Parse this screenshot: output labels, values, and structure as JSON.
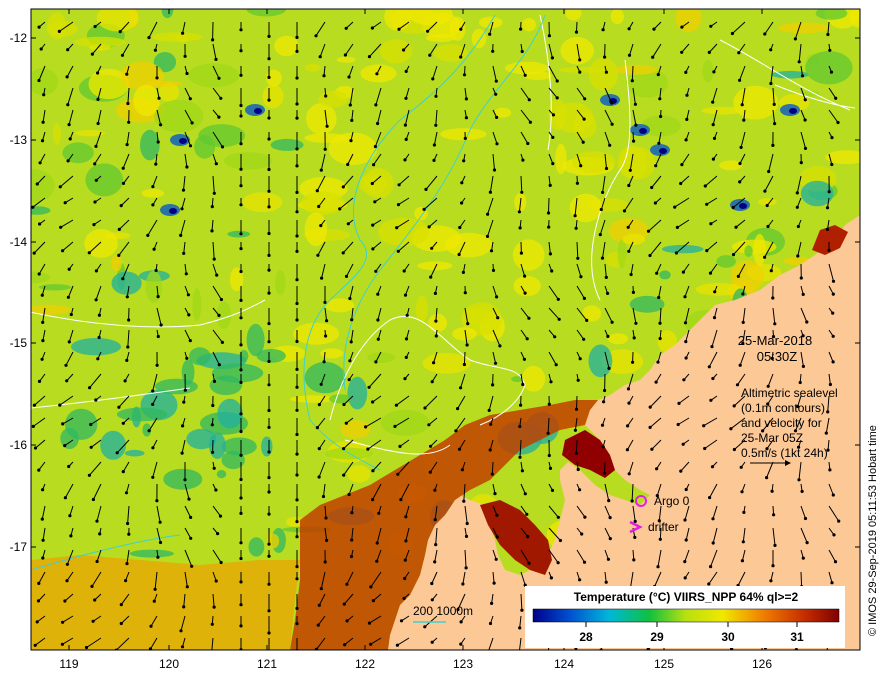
{
  "map": {
    "x_ticks": [
      "119",
      "120",
      "121",
      "122",
      "123",
      "124",
      "125",
      "126"
    ],
    "y_ticks": [
      "-12",
      "-13",
      "-14",
      "-15",
      "-16",
      "-17"
    ],
    "grid": false
  },
  "timestamp": {
    "date": "25-Mar-2018",
    "time": "05:30Z"
  },
  "altimetry_note": {
    "line1": "Altimetric sealevel",
    "line2": "(0.1m contours)",
    "line3": "and velocity for",
    "line4": "25-Mar 05Z",
    "line5": "0.5m/s (1kt 24h)"
  },
  "legend": {
    "argo_label": "Argo 0",
    "drifter_label": "drifter",
    "depth_label": "200  1000m"
  },
  "colorbar": {
    "title": "Temperature (°C) VIIRS_NPP 64% ql>=2",
    "ticks": [
      "28",
      "29",
      "30",
      "31"
    ],
    "colors": [
      "#00008b",
      "#0050d0",
      "#00b8d8",
      "#10c040",
      "#b8e010",
      "#f0e800",
      "#f08000",
      "#c83000",
      "#800000"
    ]
  },
  "credit": "© IMOS 29-Sep-2019 05:11:53 Hobart time",
  "palette": {
    "land": "#fcc896",
    "sst_mid": "#b8dc20",
    "contour_white": "#ffffff",
    "isobath": "#40d0d0",
    "argo_marker": "#e020e0"
  }
}
